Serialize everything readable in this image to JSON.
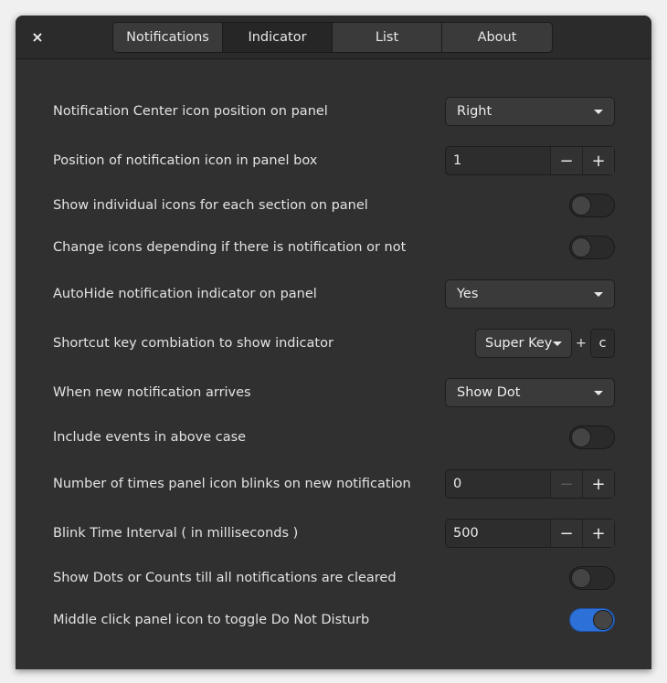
{
  "window": {
    "close_glyph": "×"
  },
  "tabs": [
    {
      "label": "Notifications"
    },
    {
      "label": "Indicator",
      "active": true
    },
    {
      "label": "List"
    },
    {
      "label": "About"
    }
  ],
  "settings": {
    "icon_position": {
      "label": "Notification Center icon position on panel",
      "value": "Right"
    },
    "icon_box_position": {
      "label": "Position of notification icon in panel box",
      "value": "1"
    },
    "individual_icons": {
      "label": "Show individual icons for each section on panel",
      "enabled": false
    },
    "change_icons": {
      "label": "Change icons depending if there is notification or not",
      "enabled": false
    },
    "autohide": {
      "label": "AutoHide notification indicator on panel",
      "value": "Yes"
    },
    "shortcut": {
      "label": "Shortcut key combiation to show indicator",
      "modifier": "Super Key",
      "plus": "+",
      "key": "c"
    },
    "new_notification": {
      "label": "When new notification arrives",
      "value": "Show Dot"
    },
    "include_events": {
      "label": "Include events in above case",
      "enabled": false
    },
    "blink_times": {
      "label": "Number of times panel icon blinks on new notification",
      "value": "0"
    },
    "blink_interval": {
      "label": "Blink Time Interval ( in milliseconds )",
      "value": "500"
    },
    "dots_counts": {
      "label": "Show Dots or Counts till all notifications are cleared",
      "enabled": false
    },
    "middle_click_dnd": {
      "label": "Middle click panel icon to toggle Do Not Disturb",
      "enabled": true
    }
  },
  "glyphs": {
    "minus": "−",
    "plus": "+"
  },
  "colors": {
    "accent": "#2c70d8",
    "background": "#303030"
  }
}
